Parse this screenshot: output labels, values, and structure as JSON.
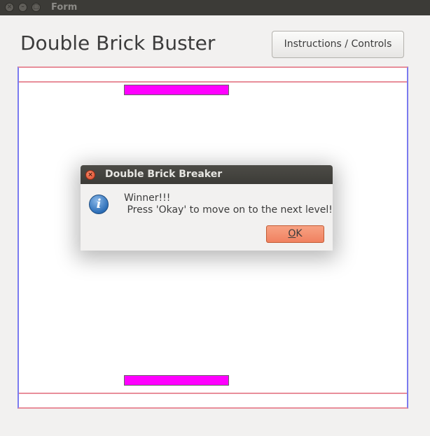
{
  "window": {
    "title": "Form",
    "close_glyph": "×",
    "minimize_glyph": "–",
    "maximize_glyph": "□"
  },
  "header": {
    "app_title": "Double Brick Buster",
    "instructions_button": "Instructions / Controls"
  },
  "game": {
    "paddle_color": "#ff00ff",
    "boundary_color_horizontal": "#e88e9a",
    "boundary_color_vertical": "#7b7bef"
  },
  "dialog": {
    "title": "Double Brick Breaker",
    "close_glyph": "×",
    "icon": "info-icon",
    "icon_glyph": "i",
    "message_line1": "Winner!!!",
    "message_line2": " Press 'Okay' to move on to the next level!",
    "ok_mnemonic": "O",
    "ok_rest": "K"
  }
}
